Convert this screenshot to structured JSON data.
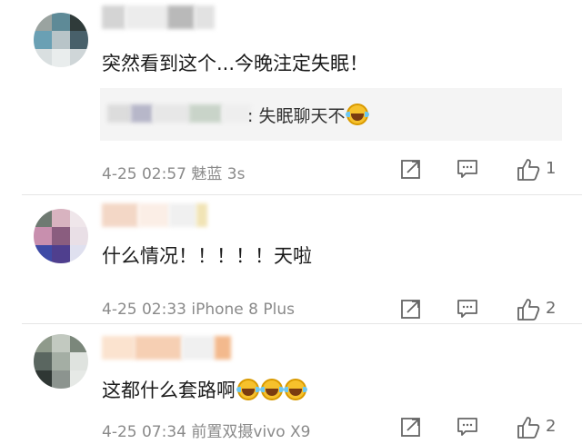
{
  "comments": [
    {
      "avatar_colors": [
        "#9aa3a0",
        "#5e8a97",
        "#2f3b3a",
        "#6aa0b4",
        "#b8c4c8",
        "#48606a",
        "#d9dfe0",
        "#e9eded",
        "#cfd6d8"
      ],
      "username_blur_colors": [
        "#d4d4d4",
        "#ececec",
        "#b9b9b9",
        "#e2e2e2"
      ],
      "text": "突然看到这个...今晚注定失眠！",
      "reply": {
        "name_blur_colors": [
          "#dcdcdc",
          "#b7b7c9",
          "#e7e7e7",
          "#c9d4c9",
          "#eeeeee"
        ],
        "text": ": 失眠聊天不",
        "emoji": "laugh-cry-emoji"
      },
      "meta": "4-25 02:57 魅蓝 3s",
      "likes": "1"
    },
    {
      "avatar_colors": [
        "#6f7a72",
        "#d8b3c0",
        "#efe6ea",
        "#c88fae",
        "#8a5d7f",
        "#e9dfe6",
        "#3e4aa5",
        "#4f3f8e",
        "#dfe0ef"
      ],
      "username_blur_colors": [
        "#f3d7c6",
        "#fbeee6",
        "#f0f0f0",
        "#f1e4b5"
      ],
      "text": "什么情况！！！！！天啦",
      "meta": "4-25 02:33 iPhone 8 Plus",
      "likes": "2"
    },
    {
      "avatar_colors": [
        "#8f9a8b",
        "#c2c9c0",
        "#7b877b",
        "#5a6660",
        "#a4aea4",
        "#dfe3df",
        "#2f3734",
        "#8c948f",
        "#e6e9e6"
      ],
      "username_blur_colors": [
        "#fbe3cf",
        "#f6cfb3",
        "#f0f0f0",
        "#f3b98d"
      ],
      "text": "这都什么套路啊",
      "emojis": [
        "laugh-cry-emoji",
        "laugh-cry-emoji",
        "laugh-cry-emoji"
      ],
      "meta": "4-25 07:34 前置双摄vivo X9",
      "likes": "2"
    }
  ],
  "icons": {
    "share": "share-icon",
    "comment": "comment-icon",
    "like": "thumbs-up-icon"
  },
  "colors": {
    "meta_text": "#8a8a8a",
    "reply_bg": "#f4f4f4",
    "icon_stroke": "#666666"
  }
}
